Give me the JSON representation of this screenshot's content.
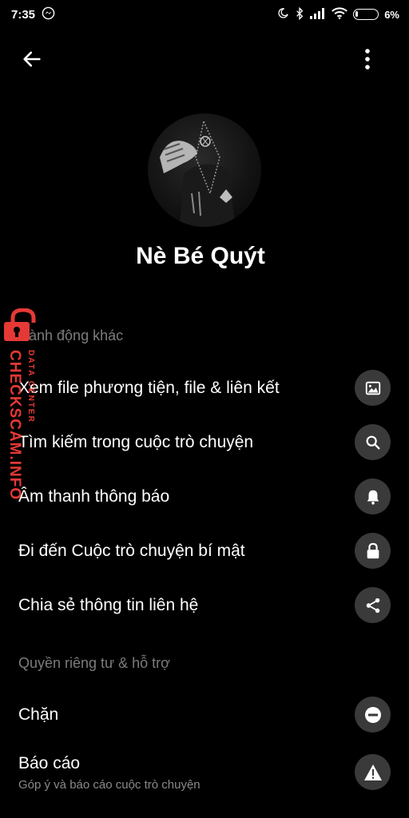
{
  "status_bar": {
    "time": "7:35",
    "battery": "6%",
    "icons": [
      "messenger-icon",
      "moon-icon",
      "bluetooth-icon",
      "signal-icon",
      "wifi-icon",
      "battery-icon"
    ]
  },
  "app_bar": {
    "back_icon": "arrow-left-icon",
    "more_icon": "more-vertical-icon"
  },
  "profile": {
    "name": "Nè Bé Quýt"
  },
  "sections": {
    "other_actions": {
      "title": "Hành động khác",
      "items": [
        {
          "label": "Xem file phương tiện, file & liên kết",
          "icon": "image-icon"
        },
        {
          "label": "Tìm kiếm trong cuộc trò chuyện",
          "icon": "search-icon"
        },
        {
          "label": "Âm thanh thông báo",
          "icon": "bell-icon"
        },
        {
          "label": "Đi đến Cuộc trò chuyện bí mật",
          "icon": "lock-icon"
        },
        {
          "label": "Chia sẻ thông tin liên hệ",
          "icon": "share-icon"
        }
      ]
    },
    "privacy": {
      "title": "Quyền riêng tư & hỗ trợ",
      "items": [
        {
          "label": "Chặn",
          "icon": "block-icon"
        },
        {
          "label": "Báo cáo",
          "sublabel": "Góp ý và báo cáo cuộc trò chuyện",
          "icon": "warning-icon"
        }
      ]
    }
  },
  "watermark": {
    "main": "CHECKSCAM.INFO",
    "small": "DATA CENTER",
    "color": "#e53935"
  },
  "colors": {
    "background": "#000000",
    "icon_circle": "#3a3a3a",
    "section_header": "#7c7c7c",
    "watermark_red": "#e53935"
  }
}
